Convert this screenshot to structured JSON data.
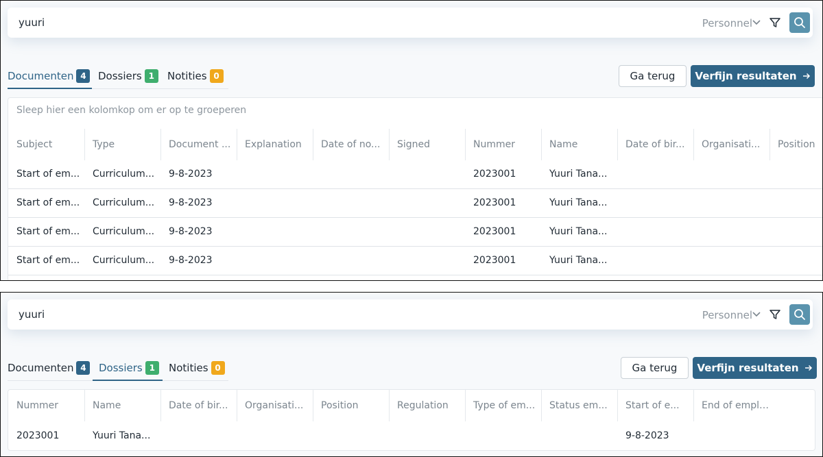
{
  "search": {
    "query": "yuuri",
    "scope": "Personnel"
  },
  "tabs": [
    {
      "label": "Documenten",
      "count": "4"
    },
    {
      "label": "Dossiers",
      "count": "1"
    },
    {
      "label": "Notities",
      "count": "0"
    }
  ],
  "buttons": {
    "back": "Ga terug",
    "refine": "Verfijn resultaten"
  },
  "colors": {
    "accent": "#2f6487",
    "search_button": "#5a93ad",
    "badge_documents": "#2f6487",
    "badge_dossiers": "#3fae6e",
    "badge_notes": "#f0a81c"
  },
  "icons": {
    "scope_toggle": "chevron-down-icon",
    "filter": "filter-icon",
    "search": "search-icon",
    "refine_arrow": "arrow-right-icon"
  },
  "documents_view": {
    "active_tab": "Documenten",
    "group_hint": "Sleep hier een kolomkop om er op te groeperen",
    "columns": [
      "Subject",
      "Type",
      "Document ...",
      "Explanation",
      "Date of no...",
      "Signed",
      "Nummer",
      "Name",
      "Date of bir...",
      "Organisati...",
      "Position"
    ],
    "rows": [
      [
        "Start of em...",
        "Curriculum...",
        "9-8-2023",
        "",
        "",
        "",
        "2023001",
        "Yuuri Tana...",
        "",
        "",
        ""
      ],
      [
        "Start of em...",
        "Curriculum...",
        "9-8-2023",
        "",
        "",
        "",
        "2023001",
        "Yuuri Tana...",
        "",
        "",
        ""
      ],
      [
        "Start of em...",
        "Curriculum...",
        "9-8-2023",
        "",
        "",
        "",
        "2023001",
        "Yuuri Tana...",
        "",
        "",
        ""
      ],
      [
        "Start of em...",
        "Curriculum...",
        "9-8-2023",
        "",
        "",
        "",
        "2023001",
        "Yuuri Tana...",
        "",
        "",
        ""
      ]
    ]
  },
  "dossiers_view": {
    "active_tab": "Dossiers",
    "columns": [
      "Nummer",
      "Name",
      "Date of bir...",
      "Organisati...",
      "Position",
      "Regulation",
      "Type of em...",
      "Status em...",
      "Start of e...",
      "End of employment"
    ],
    "rows": [
      [
        "2023001",
        "Yuuri Tana...",
        "",
        "",
        "",
        "",
        "",
        "",
        "9-8-2023",
        ""
      ]
    ]
  }
}
